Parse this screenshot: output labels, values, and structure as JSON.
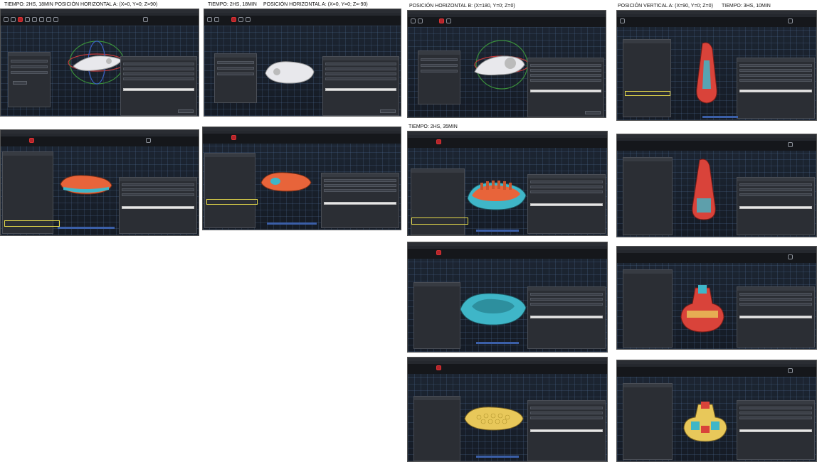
{
  "captions": {
    "r1c1": "TIEMPO: 2HS, 18MIN      POSICIÓN HORIZONTAL A:  (X=0, Y=0; Z=90)",
    "r1c2a": "TIEMPO: 2HS, 18MIN",
    "r1c2b": "POSICIÓN HORIZONTAL A:  (X=0, Y=0; Z=-90)",
    "r1c3": "POSICIÓN HORIZONTAL B:  (X=180, Y=0; Z=0)",
    "r1c4a": "POSICIÓN VERTICAL A:  (X=90, Y=0; Z=0)",
    "r1c4b": "TIEMPO: 3HS, 10MIN",
    "r2c3": "TIEMPO: 2HS, 35MIN"
  },
  "colors": {
    "highlight": "#e4d84a",
    "brand_red": "#b3242b",
    "model_white": "#e8e8ec",
    "model_orange": "#e8643a",
    "model_teal": "#3fb6c8",
    "model_yellow": "#e8c85a",
    "model_red": "#d9433a"
  },
  "icons": [
    "rotate-gizmo-icon",
    "cut-icon",
    "support-icon",
    "seam-icon",
    "paint-icon",
    "layer-icon"
  ]
}
